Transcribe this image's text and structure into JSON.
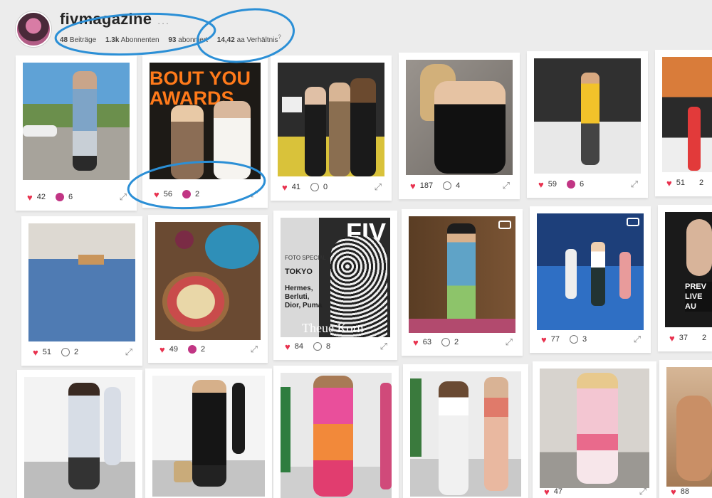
{
  "profile": {
    "username": "fivmagazine",
    "more": "...",
    "stats": [
      {
        "value": "48",
        "label": "Beiträge"
      },
      {
        "value": "1.3k",
        "label": "Abonnenten"
      },
      {
        "value": "93",
        "label": "abonniert"
      },
      {
        "value": "14,42",
        "label": "aa Verhältnis",
        "sup": "?"
      }
    ]
  },
  "posts": [
    {
      "likes": "42",
      "comments": "6",
      "comment_style": "filled"
    },
    {
      "likes": "56",
      "comments": "2",
      "comment_style": "filled"
    },
    {
      "likes": "41",
      "comments": "0",
      "comment_style": "empty"
    },
    {
      "likes": "187",
      "comments": "4",
      "comment_style": "empty"
    },
    {
      "likes": "59",
      "comments": "6",
      "comment_style": "filled"
    },
    {
      "likes": "51",
      "comments": "2",
      "comment_style": "filled"
    },
    {
      "likes": "51",
      "comments": "2",
      "comment_style": "empty"
    },
    {
      "likes": "49",
      "comments": "2",
      "comment_style": "filled"
    },
    {
      "likes": "84",
      "comments": "8",
      "comment_style": "empty"
    },
    {
      "likes": "63",
      "comments": "2",
      "comment_style": "empty"
    },
    {
      "likes": "77",
      "comments": "3",
      "comment_style": "empty"
    },
    {
      "likes": "37",
      "comments": "2",
      "comment_style": "filled"
    },
    {
      "likes": "",
      "comments": "",
      "comment_style": "empty"
    },
    {
      "likes": "",
      "comments": "",
      "comment_style": "empty"
    },
    {
      "likes": "",
      "comments": "",
      "comment_style": "empty"
    },
    {
      "likes": "",
      "comments": "",
      "comment_style": "empty"
    },
    {
      "likes": "47",
      "comments": "",
      "comment_style": "empty"
    },
    {
      "likes": "88",
      "comments": "",
      "comment_style": "empty"
    }
  ],
  "photo_text": {
    "awards": "BOUT YOU AWARDS",
    "cover_brand": "FIV",
    "cover_special": "FOTO SPECIAL",
    "cover_city": "TOKYO",
    "cover_list": "Hermes, Berluti, Dior, Puma",
    "cover_name": "Theue Korn",
    "live_banner": "PREV LIVE AU"
  },
  "colors": {
    "accent": "#2b8fd6",
    "like": "#e8314e",
    "comment": "#c13584"
  }
}
